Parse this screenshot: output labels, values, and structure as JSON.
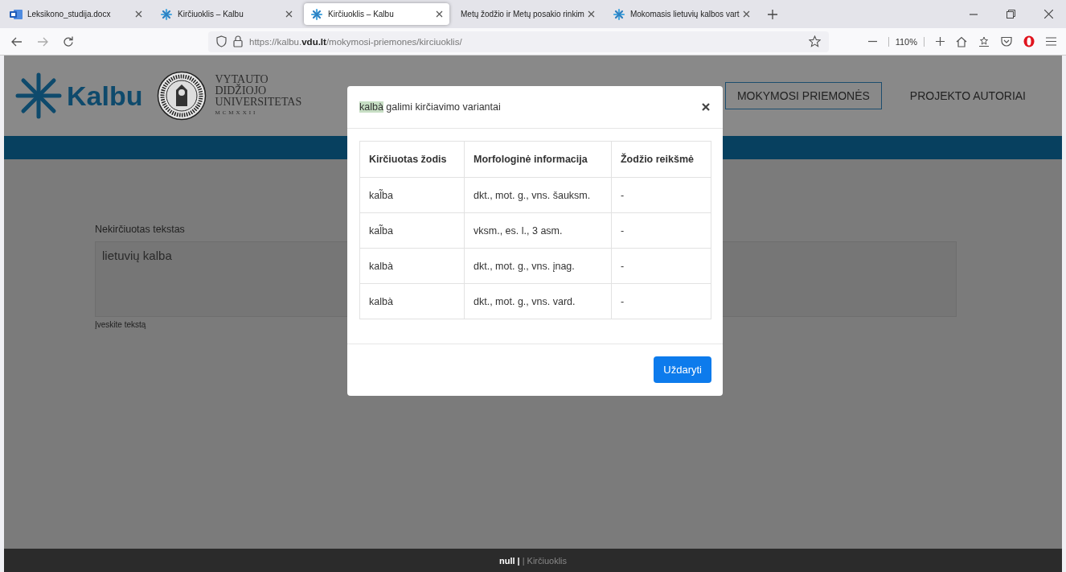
{
  "browser": {
    "tabs": [
      {
        "label": "Leksikono_studija.docx",
        "kind": "document",
        "selected": false
      },
      {
        "label": "Kirčiuoklis – Kalbu",
        "kind": "site",
        "selected": false
      },
      {
        "label": "Kirčiuoklis – Kalbu",
        "kind": "site",
        "selected": true
      },
      {
        "label": "Metų žodžio ir Metų posakio rinkim",
        "kind": "plain",
        "selected": false
      },
      {
        "label": "Mokomasis lietuvių kalbos vart",
        "kind": "site",
        "selected": false
      }
    ],
    "address": {
      "prefix": "https://kalbu.",
      "domain": "vdu.lt",
      "path": "/mokymosi-priemones/kirciuoklis/"
    },
    "zoom": "110%"
  },
  "header": {
    "logo_text": "Kalbu",
    "university": [
      "VYTAUTO",
      "DIDŽIOJO",
      "UNIVERSITETAS"
    ],
    "founded": "MCMXXII",
    "nav": [
      {
        "label": "MOKYMOSI PRIEMONĖS",
        "selected": true
      },
      {
        "label": "PROJEKTO AUTORIAI",
        "selected": false
      }
    ]
  },
  "form": {
    "label": "Nekirčiuotas tekstas",
    "value": "lietuvių kalba",
    "hint": "Įveskite tekstą"
  },
  "modal": {
    "title_word": "kalbà",
    "title_text": "galimi kirčiavimo variantai",
    "table": {
      "columns": [
        "Kirčiuotas žodis",
        "Morfologinė informacija",
        "Žodžio reikšmė"
      ],
      "rows": [
        [
          "kal̃ba",
          "dkt., mot. g., vns. šauksm.",
          "-"
        ],
        [
          "kal̃ba",
          "vksm., es. l., 3 asm.",
          "-"
        ],
        [
          "kalbà",
          "dkt., mot. g., vns. įnag.",
          "-"
        ],
        [
          "kalbà",
          "dkt., mot. g., vns. vard.",
          "-"
        ]
      ]
    },
    "close_button": "Uždaryti"
  },
  "footer": [
    {
      "text": "null |",
      "kind": "strong"
    },
    {
      "text": "| Kirčiuoklis",
      "kind": "muted"
    }
  ]
}
